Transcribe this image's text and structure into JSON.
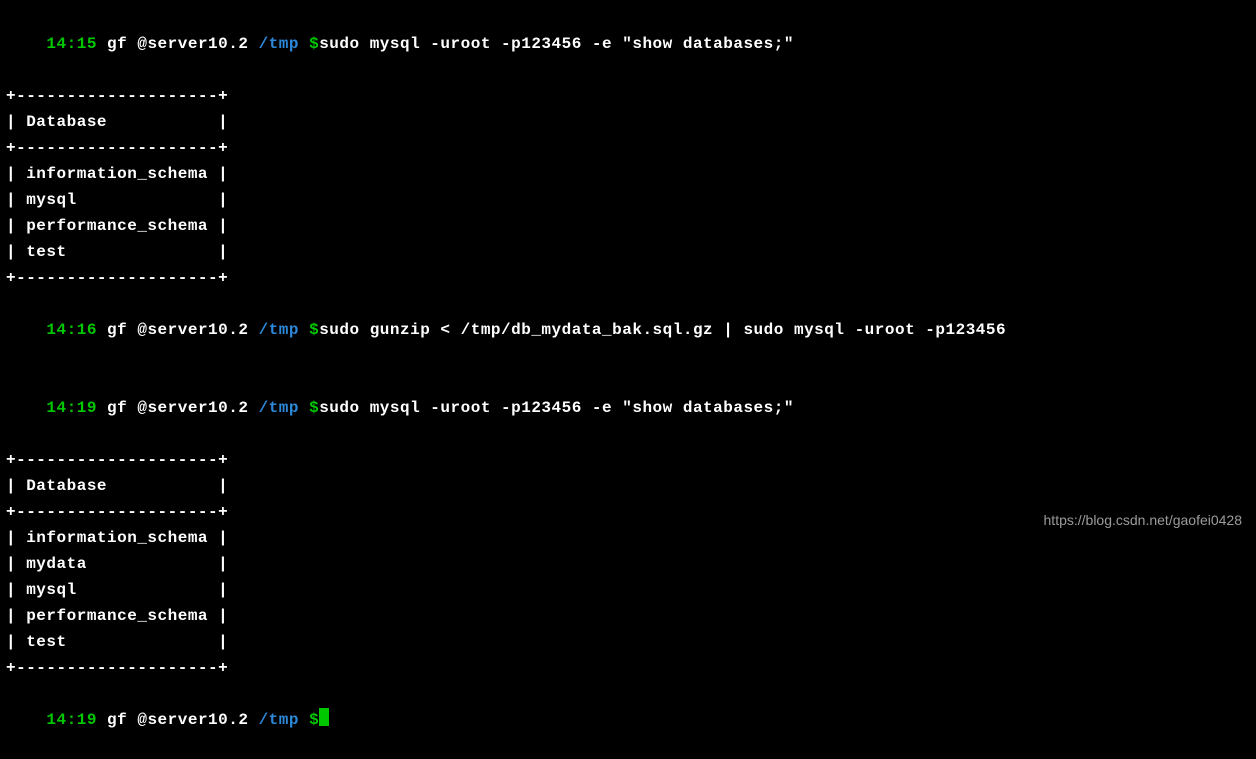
{
  "prompts": [
    {
      "time": "14:15",
      "user": "gf @server10.2",
      "dir": "/tmp",
      "sigil": "$",
      "cmd": "sudo mysql -uroot -p123456 -e \"show databases;\""
    },
    {
      "time": "14:16",
      "user": "gf @server10.2",
      "dir": "/tmp",
      "sigil": "$",
      "cmd": "sudo gunzip < /tmp/db_mydata_bak.sql.gz | sudo mysql -uroot -p123456"
    },
    {
      "time": "14:19",
      "user": "gf @server10.2",
      "dir": "/tmp",
      "sigil": "$",
      "cmd": "sudo mysql -uroot -p123456 -e \"show databases;\""
    },
    {
      "time": "14:19",
      "user": "gf @server10.2",
      "dir": "/tmp",
      "sigil": "$",
      "cmd": ""
    }
  ],
  "tables": {
    "sep": "+--------------------+",
    "header": "| Database           |",
    "rows1": [
      "| information_schema |",
      "| mysql              |",
      "| performance_schema |",
      "| test               |"
    ],
    "rows2": [
      "| information_schema |",
      "| mydata             |",
      "| mysql              |",
      "| performance_schema |",
      "| test               |"
    ]
  },
  "watermark": "https://blog.csdn.net/gaofei0428"
}
